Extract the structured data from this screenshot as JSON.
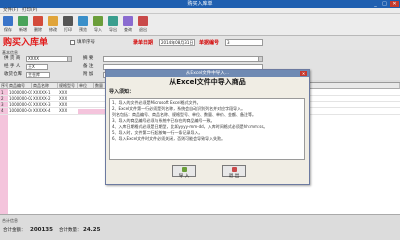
{
  "window": {
    "title": "购买入库单",
    "minimize": "_",
    "maximize": "□",
    "close": "✕"
  },
  "menu": [
    "文件(F)",
    "打印(P)"
  ],
  "toolbar": [
    {
      "label": "保存",
      "color": "#3a74c9"
    },
    {
      "label": "新增",
      "color": "#4aa35a"
    },
    {
      "label": "删除",
      "color": "#d34b3a"
    },
    {
      "label": "修改",
      "color": "#e0a43a"
    },
    {
      "label": "打印",
      "color": "#555555"
    },
    {
      "label": "预览",
      "color": "#3a8fc9"
    },
    {
      "label": "导入",
      "color": "#6b9e3a"
    },
    {
      "label": "导出",
      "color": "#3a9e8e"
    },
    {
      "label": "查询",
      "color": "#8a6bd0"
    },
    {
      "label": "退出",
      "color": "#c94a4a"
    }
  ],
  "header": {
    "title": "购买入库单",
    "checkbox_label": "填单序号",
    "date_label": "录单日期",
    "date_value": "2014年08月31日",
    "doc_label": "单据编号",
    "doc_value": "3"
  },
  "form": {
    "section_label": "基本信息",
    "supplier_label": "供 货 商",
    "supplier_value": "XXXX",
    "agent_label": "经 手 人",
    "agent_value": "王X",
    "warehouse_label": "收货仓库",
    "warehouse_value": "主仓库",
    "summary_label": "摘    要",
    "remark_label": "备    注",
    "extra_label": "附    加"
  },
  "grid": {
    "headers": [
      "序号",
      "商品编号",
      "商品名称",
      "规格型号",
      "单位",
      "数量",
      "单价",
      "金额",
      "备注"
    ],
    "rows": [
      {
        "no": "1",
        "code": "1000000-01",
        "name": "XXXXX-1",
        "spec": "XXX"
      },
      {
        "no": "2",
        "code": "1000000-02",
        "name": "XXXXX-2",
        "spec": "XXX"
      },
      {
        "no": "3",
        "code": "1000000-03",
        "name": "XXXXX-3",
        "spec": "XXX"
      },
      {
        "no": "4",
        "code": "1000000-04",
        "name": "XXXXX-4",
        "spec": "XXX"
      }
    ]
  },
  "footer": {
    "section_label": "合计信息",
    "total_amount_label": "合计金额：",
    "total_amount_value": "200135",
    "total_qty_label": "合计数量：",
    "total_qty_value": "24.25"
  },
  "dialog": {
    "title": "从Excel文件中导入...",
    "close": "✕",
    "heading": "从Excel文件中导入商品",
    "guide_label": "导入须知：",
    "instructions": [
      "1、导入的文件必须是Microsoft Excel格式文件。",
      "2、Excel文件第一行必须是列名称，系统会自动识别列名并对应字段导入。",
      "   列名包括：商品编号、商品名称、规格型号、单位、数量、单价、金额、备注等。",
      "3、导入的商品编号必须与系统中已存在的商品编号一致。",
      "4、入库日期格式必须是日期型，比如yyyy-mm-dd，入库时间格式必须是hh:mm:ss。",
      "5、导入时，文件第二行起按每一行一条记录导入。",
      "6、导入Excel文件时文件必须关闭，否则可能会导致导入失败。"
    ],
    "import_label": "导 入",
    "exit_label": "退 出"
  }
}
